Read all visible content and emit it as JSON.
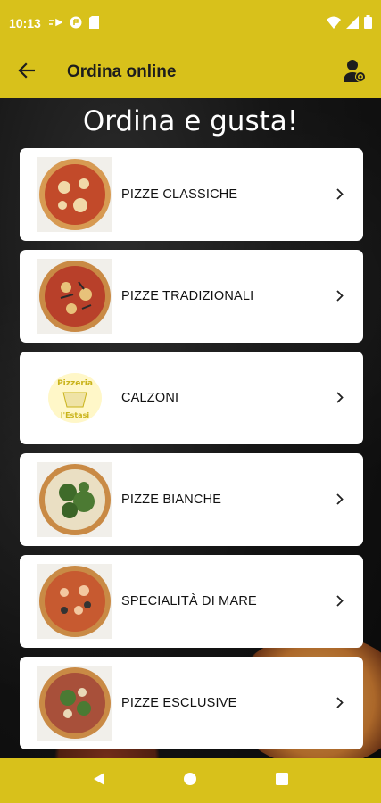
{
  "status": {
    "time": "10:13"
  },
  "toolbar": {
    "title": "Ordina online"
  },
  "headline": "Ordina e gusta!",
  "categories": [
    {
      "label": "PIZZE CLASSICHE",
      "thumb": "pizza-margherita"
    },
    {
      "label": "PIZZE TRADIZIONALI",
      "thumb": "pizza-tradizionale"
    },
    {
      "label": "CALZONI",
      "thumb": "pizzeria-logo"
    },
    {
      "label": "PIZZE BIANCHE",
      "thumb": "pizza-rucola"
    },
    {
      "label": "SPECIALITÀ DI MARE",
      "thumb": "pizza-mare"
    },
    {
      "label": "PIZZE ESCLUSIVE",
      "thumb": "pizza-esclusiva"
    }
  ],
  "logo_text": [
    "Pizzeria",
    "l'Estasi"
  ],
  "colors": {
    "accent": "#d8c11b",
    "card": "#ffffff",
    "background": "#111111"
  }
}
